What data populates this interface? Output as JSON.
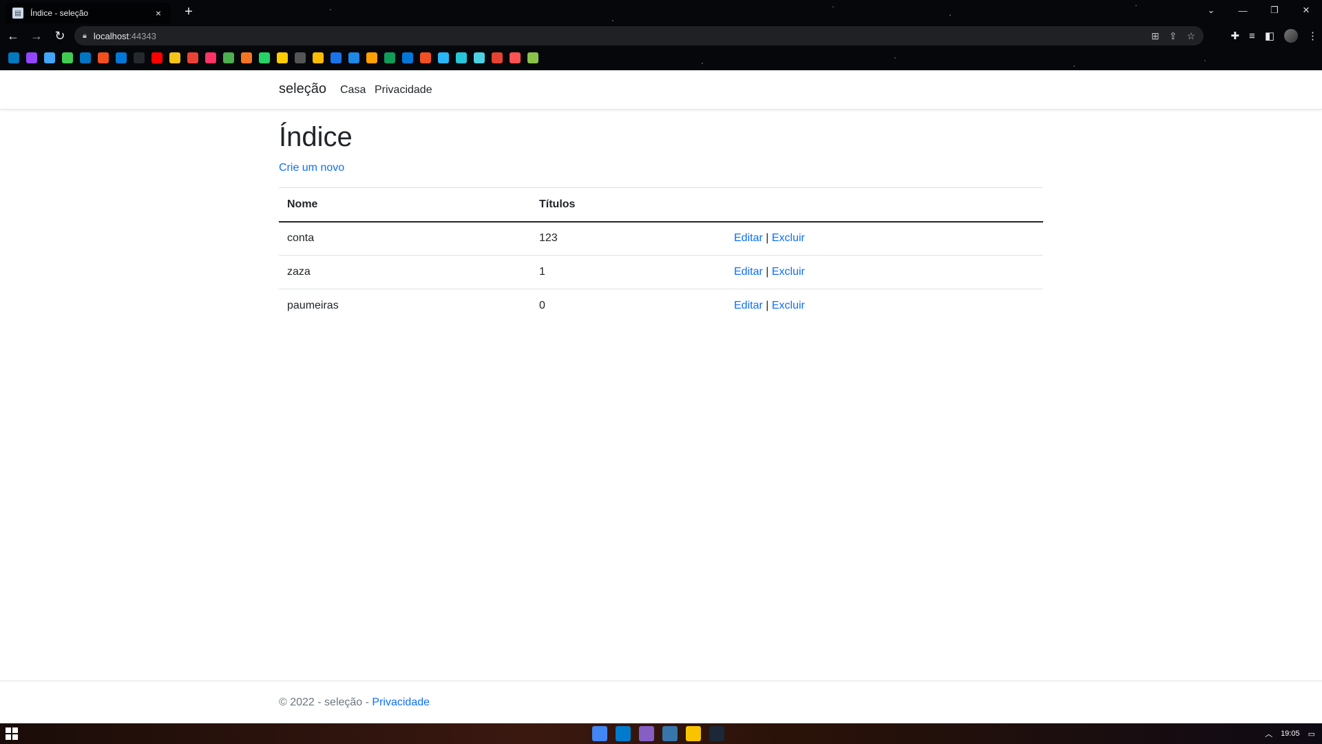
{
  "browser": {
    "tab_title": "Índice - seleção",
    "tab_close": "×",
    "new_tab": "+",
    "url_host": "localhost",
    "url_port": ":44343",
    "window_controls": [
      "⌄",
      "—",
      "❐",
      "✕"
    ]
  },
  "navbar": {
    "brand": "seleção",
    "links": [
      "Casa",
      "Privacidade"
    ]
  },
  "main": {
    "heading": "Índice",
    "create_link": "Crie um novo",
    "table": {
      "headers": [
        "Nome",
        "Títulos",
        ""
      ],
      "rows": [
        {
          "nome": "conta",
          "titulos": "123",
          "edit": "Editar",
          "sep": "|",
          "delete": "Excluir"
        },
        {
          "nome": "zaza",
          "titulos": "1",
          "edit": "Editar",
          "sep": "|",
          "delete": "Excluir"
        },
        {
          "nome": "paumeiras",
          "titulos": "0",
          "edit": "Editar",
          "sep": "|",
          "delete": "Excluir"
        }
      ]
    }
  },
  "footer": {
    "text": "© 2022 - seleção - ",
    "link": "Privacidade"
  },
  "taskbar": {
    "clock": "19:05"
  },
  "colors": {
    "link": "#0d6efd",
    "text": "#212529",
    "border": "#dee2e6"
  },
  "bookmark_icons": [
    {
      "name": "trello-icon",
      "color": "#0079bf"
    },
    {
      "name": "twitch-icon",
      "color": "#9146ff"
    },
    {
      "name": "flutter-icon",
      "color": "#42a5f5"
    },
    {
      "name": "qt-icon",
      "color": "#41cd52"
    },
    {
      "name": "dart-icon",
      "color": "#0175c2"
    },
    {
      "name": "figma-icon",
      "color": "#f24e1e"
    },
    {
      "name": "azure-devops-icon",
      "color": "#0078d7"
    },
    {
      "name": "github-icon",
      "color": "#24292e"
    },
    {
      "name": "youtube-icon",
      "color": "#ff0000"
    },
    {
      "name": "bookmark-icon",
      "color": "#f5c518"
    },
    {
      "name": "gmail-icon",
      "color": "#ea4335"
    },
    {
      "name": "invision-icon",
      "color": "#ff3366"
    },
    {
      "name": "colors-icon",
      "color": "#4caf50"
    },
    {
      "name": "crunchyroll-icon",
      "color": "#f47521"
    },
    {
      "name": "whatsapp-icon",
      "color": "#25d366"
    },
    {
      "name": "o-icon",
      "color": "#ffcc00"
    },
    {
      "name": "clock-icon",
      "color": "#555555"
    },
    {
      "name": "keep-icon",
      "color": "#fbbc04"
    },
    {
      "name": "calendar-icon",
      "color": "#1a73e8"
    },
    {
      "name": "photos-icon",
      "color": "#1e88e5"
    },
    {
      "name": "firebase-icon",
      "color": "#ffa000"
    },
    {
      "name": "sheets-icon",
      "color": "#0f9d58"
    },
    {
      "name": "edge-icon",
      "color": "#0078d7"
    },
    {
      "name": "microsoft-icon",
      "color": "#f25022"
    },
    {
      "name": "app-icon-1",
      "color": "#29b6f6"
    },
    {
      "name": "app-icon-2",
      "color": "#26c6da"
    },
    {
      "name": "app-icon-3",
      "color": "#4dd0e1"
    },
    {
      "name": "todoist-icon",
      "color": "#e44332"
    },
    {
      "name": "app-icon-4",
      "color": "#ff5252"
    },
    {
      "name": "app-icon-5",
      "color": "#8bc34a"
    }
  ],
  "taskbar_apps": [
    {
      "name": "chrome-icon",
      "color": "#4285f4"
    },
    {
      "name": "vscode-icon",
      "color": "#007acc"
    },
    {
      "name": "visual-studio-icon",
      "color": "#865fc5"
    },
    {
      "name": "python-icon",
      "color": "#3776ab"
    },
    {
      "name": "file-explorer-icon",
      "color": "#f8c400"
    },
    {
      "name": "steam-icon",
      "color": "#1b2838"
    }
  ]
}
